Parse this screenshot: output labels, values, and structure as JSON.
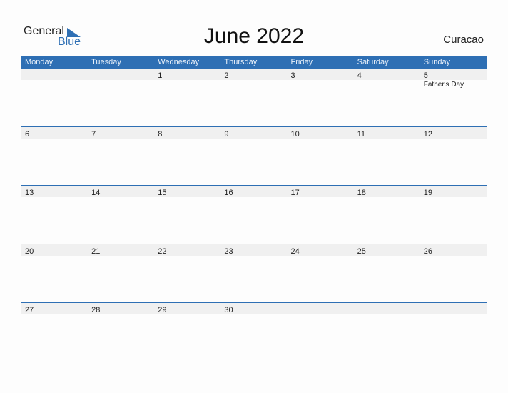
{
  "logo": {
    "general": "General",
    "blue": "Blue"
  },
  "title": "June 2022",
  "country": "Curacao",
  "colors": {
    "accent": "#2e6fb4",
    "strip": "#f0f0f0"
  },
  "weekdays": [
    "Monday",
    "Tuesday",
    "Wednesday",
    "Thursday",
    "Friday",
    "Saturday",
    "Sunday"
  ],
  "weeks": [
    [
      {
        "d": ""
      },
      {
        "d": ""
      },
      {
        "d": "1"
      },
      {
        "d": "2"
      },
      {
        "d": "3"
      },
      {
        "d": "4"
      },
      {
        "d": "5",
        "event": "Father's Day"
      }
    ],
    [
      {
        "d": "6"
      },
      {
        "d": "7"
      },
      {
        "d": "8"
      },
      {
        "d": "9"
      },
      {
        "d": "10"
      },
      {
        "d": "11"
      },
      {
        "d": "12"
      }
    ],
    [
      {
        "d": "13"
      },
      {
        "d": "14"
      },
      {
        "d": "15"
      },
      {
        "d": "16"
      },
      {
        "d": "17"
      },
      {
        "d": "18"
      },
      {
        "d": "19"
      }
    ],
    [
      {
        "d": "20"
      },
      {
        "d": "21"
      },
      {
        "d": "22"
      },
      {
        "d": "23"
      },
      {
        "d": "24"
      },
      {
        "d": "25"
      },
      {
        "d": "26"
      }
    ],
    [
      {
        "d": "27"
      },
      {
        "d": "28"
      },
      {
        "d": "29"
      },
      {
        "d": "30"
      },
      {
        "d": ""
      },
      {
        "d": ""
      },
      {
        "d": ""
      }
    ]
  ]
}
